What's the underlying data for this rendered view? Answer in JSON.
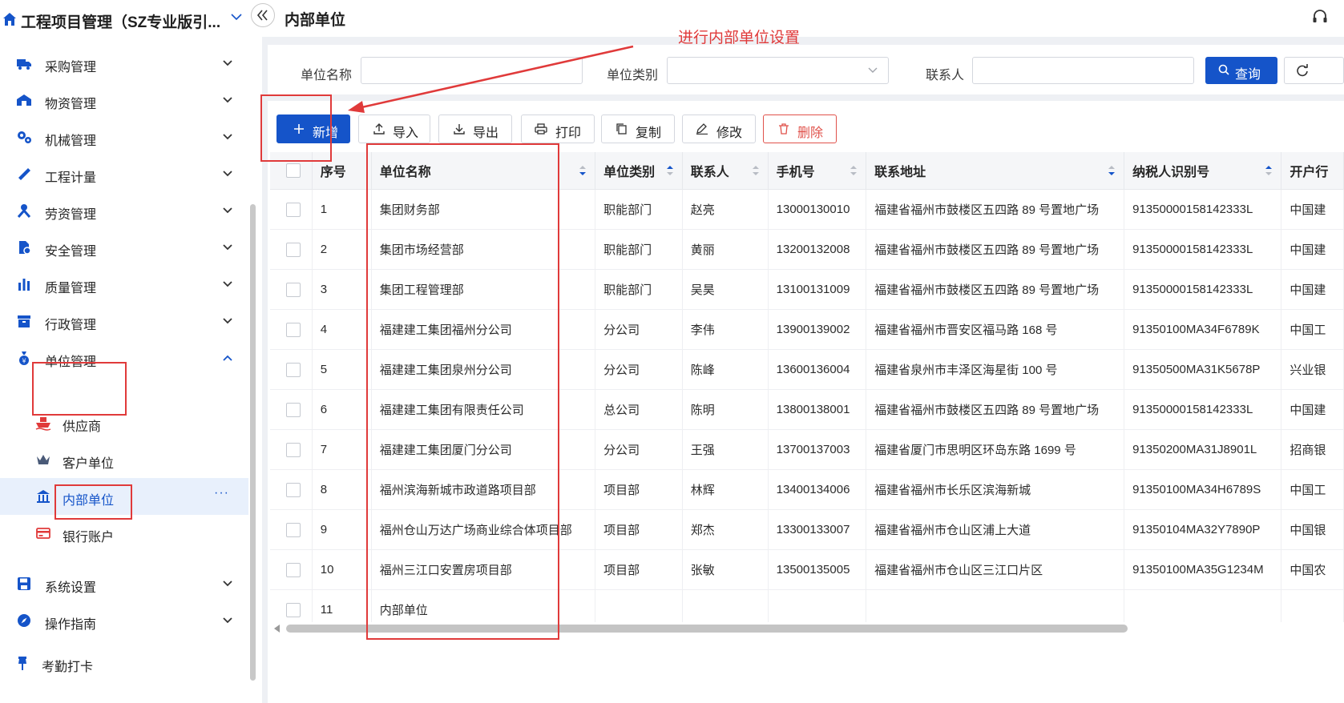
{
  "app": {
    "title": "工程项目管理（SZ专业版引..."
  },
  "sidebar": {
    "menus": [
      {
        "label": "采购管理",
        "icon": "truck-icon"
      },
      {
        "label": "物资管理",
        "icon": "warehouse-icon"
      },
      {
        "label": "机械管理",
        "icon": "gears-icon"
      },
      {
        "label": "工程计量",
        "icon": "ruler-icon"
      },
      {
        "label": "劳资管理",
        "icon": "worker-icon"
      },
      {
        "label": "安全管理",
        "icon": "shield-icon"
      },
      {
        "label": "质量管理",
        "icon": "bar-chart-icon"
      },
      {
        "label": "行政管理",
        "icon": "archive-icon"
      },
      {
        "label": "单位管理",
        "icon": "money-bag-icon",
        "expanded": true
      }
    ],
    "sub_items": [
      {
        "label": "供应商",
        "icon": "ship-icon"
      },
      {
        "label": "客户单位",
        "icon": "crown-icon"
      },
      {
        "label": "内部单位",
        "icon": "bank-icon",
        "active": true
      },
      {
        "label": "银行账户",
        "icon": "card-icon"
      }
    ],
    "bottom_menus": [
      {
        "label": "系统设置",
        "icon": "save-icon"
      },
      {
        "label": "操作指南",
        "icon": "compass-icon"
      },
      {
        "label": "考勤打卡",
        "icon": "pin-icon"
      }
    ],
    "more": "···"
  },
  "header": {
    "title": "内部单位"
  },
  "filters": {
    "unit_name_label": "单位名称",
    "unit_type_label": "单位类别",
    "contact_label": "联系人",
    "query_label": "查询"
  },
  "toolbar": {
    "add": "新增",
    "import": "导入",
    "export": "导出",
    "print": "打印",
    "copy": "复制",
    "edit": "修改",
    "delete": "删除"
  },
  "table": {
    "columns": [
      "序号",
      "单位名称",
      "单位类别",
      "联系人",
      "手机号",
      "联系地址",
      "纳税人识别号",
      "开户行"
    ],
    "rows": [
      [
        "1",
        "集团财务部",
        "职能部门",
        "赵亮",
        "13000130010",
        "福建省福州市鼓楼区五四路 89 号置地广场",
        "91350000158142333L",
        "中国建"
      ],
      [
        "2",
        "集团市场经营部",
        "职能部门",
        "黄丽",
        "13200132008",
        "福建省福州市鼓楼区五四路 89 号置地广场",
        "91350000158142333L",
        "中国建"
      ],
      [
        "3",
        "集团工程管理部",
        "职能部门",
        "吴昊",
        "13100131009",
        "福建省福州市鼓楼区五四路 89 号置地广场",
        "91350000158142333L",
        "中国建"
      ],
      [
        "4",
        "福建建工集团福州分公司",
        "分公司",
        "李伟",
        "13900139002",
        "福建省福州市晋安区福马路 168 号",
        "91350100MA34F6789K",
        "中国工"
      ],
      [
        "5",
        "福建建工集团泉州分公司",
        "分公司",
        "陈峰",
        "13600136004",
        "福建省泉州市丰泽区海星街 100 号",
        "91350500MA31K5678P",
        "兴业银"
      ],
      [
        "6",
        "福建建工集团有限责任公司",
        "总公司",
        "陈明",
        "13800138001",
        "福建省福州市鼓楼区五四路 89 号置地广场",
        "91350000158142333L",
        "中国建"
      ],
      [
        "7",
        "福建建工集团厦门分公司",
        "分公司",
        "王强",
        "13700137003",
        "福建省厦门市思明区环岛东路 1699 号",
        "91350200MA31J8901L",
        "招商银"
      ],
      [
        "8",
        "福州滨海新城市政道路项目部",
        "项目部",
        "林辉",
        "13400134006",
        "福建省福州市长乐区滨海新城",
        "91350100MA34H6789S",
        "中国工"
      ],
      [
        "9",
        "福州仓山万达广场商业综合体项目部",
        "项目部",
        "郑杰",
        "13300133007",
        "福建省福州市仓山区浦上大道",
        "91350104MA32Y7890P",
        "中国银"
      ],
      [
        "10",
        "福州三江口安置房项目部",
        "项目部",
        "张敏",
        "13500135005",
        "福建省福州市仓山区三江口片区",
        "91350100MA35G1234M",
        "中国农"
      ],
      [
        "11",
        "内部单位",
        "",
        "",
        "",
        "",
        "",
        ""
      ]
    ]
  },
  "annotation": {
    "text": "进行内部单位设置",
    "color": "#e03a3a"
  },
  "colors": {
    "primary": "#1554c9",
    "danger": "#e0524b",
    "annotation": "#e03a3a"
  }
}
